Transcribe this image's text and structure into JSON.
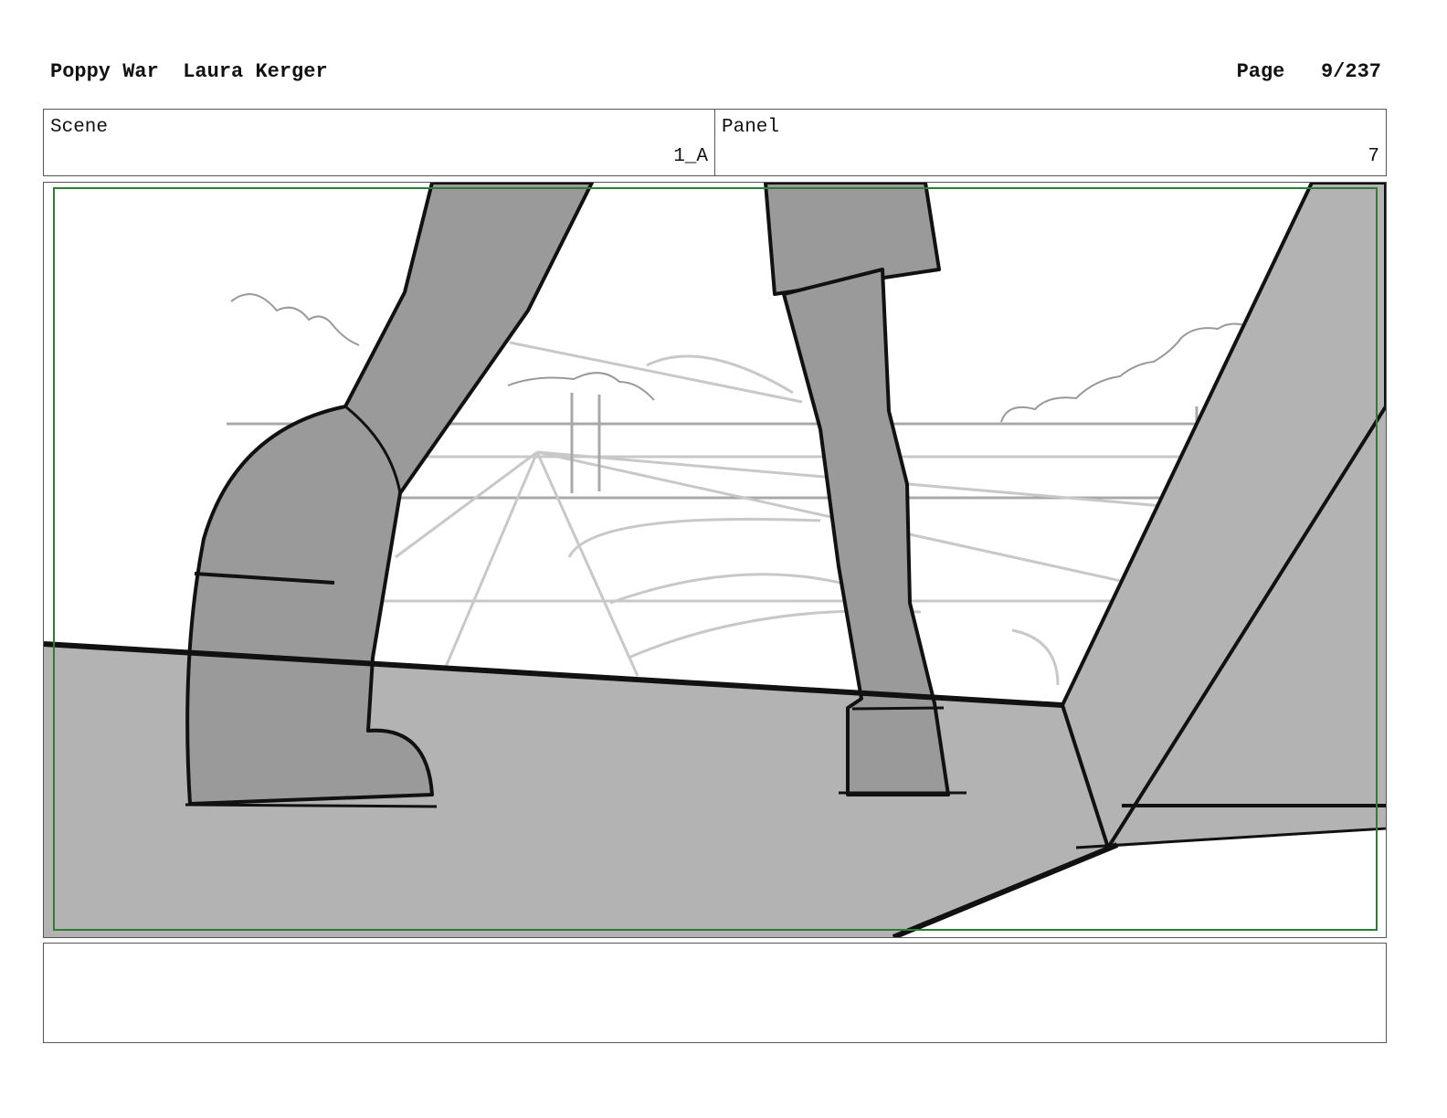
{
  "header": {
    "project": "Poppy War",
    "author": "Laura Kerger",
    "page_label": "Page",
    "page_number": "9/237"
  },
  "scene": {
    "label": "Scene",
    "value": "1_A"
  },
  "panel": {
    "label": "Panel",
    "value": "7"
  },
  "colors": {
    "safe_frame": "#2e7d32",
    "ground_fill": "#b3b3b3",
    "leg_fill": "#9a9a9a",
    "ink": "#111111",
    "sketch": "#bdbdbd"
  },
  "notes": ""
}
